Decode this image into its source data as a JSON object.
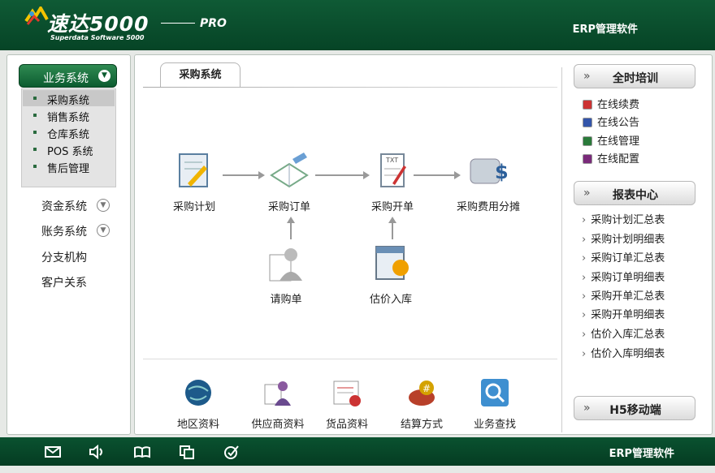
{
  "header": {
    "brand": "速达5000",
    "brand_sub": "Superdata Software 5000",
    "pro": "PRO",
    "right": "ERP管理软件"
  },
  "left_nav": {
    "active": "业务系统",
    "sub_items": [
      {
        "label": "采购系统",
        "selected": true
      },
      {
        "label": "销售系统"
      },
      {
        "label": "仓库系统"
      },
      {
        "label": "POS 系统"
      },
      {
        "label": "售后管理"
      }
    ],
    "items": [
      {
        "label": "资金系统",
        "chevron": true
      },
      {
        "label": "账务系统",
        "chevron": true
      },
      {
        "label": "分支机构",
        "chevron": false
      },
      {
        "label": "客户关系",
        "chevron": false
      }
    ]
  },
  "main": {
    "tab": "采购系统",
    "flow": [
      "采购计划",
      "采购订单",
      "采购开单",
      "采购费用分摊",
      "请购单",
      "估价入库"
    ],
    "bottom": [
      "地区资料",
      "供应商资料",
      "货品资料",
      "结算方式",
      "业务查找"
    ]
  },
  "right": {
    "training_title": "全时培训",
    "training_items": [
      "在线续费",
      "在线公告",
      "在线管理",
      "在线配置"
    ],
    "reports_title": "报表中心",
    "report_items": [
      "采购计划汇总表",
      "采购计划明细表",
      "采购订单汇总表",
      "采购订单明细表",
      "采购开单汇总表",
      "采购开单明细表",
      "估价入库汇总表",
      "估价入库明细表"
    ],
    "h5_title": "H5移动端"
  },
  "footer": {
    "right": "ERP管理软件",
    "icons": [
      "mail-icon",
      "speaker-icon",
      "book-icon",
      "copy-icon",
      "check-icon"
    ]
  }
}
